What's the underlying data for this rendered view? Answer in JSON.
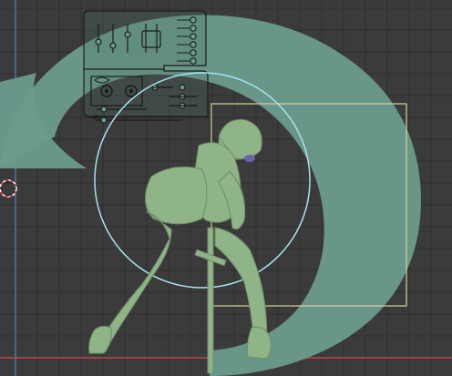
{
  "viewport": {
    "background": "#3b3b3b",
    "grid_color": "#2f2f2f",
    "axis_x_color": "#b8474b",
    "axis_y_color": "#4f79b5"
  },
  "gizmo": {
    "ring_color": "#6a9b8c",
    "circle_color": "#a7e4ef",
    "frame_color": "#d7d39a"
  },
  "model": {
    "color": "#8fb488",
    "shadow_color": "#6f8e69"
  },
  "control_panel": {
    "line_color": "#1b1b1b",
    "bg_color": "rgba(80,120,110,0.25)"
  },
  "cursor_3d": {
    "outer_color": "#ffffff",
    "inner_color": "#e34646"
  }
}
